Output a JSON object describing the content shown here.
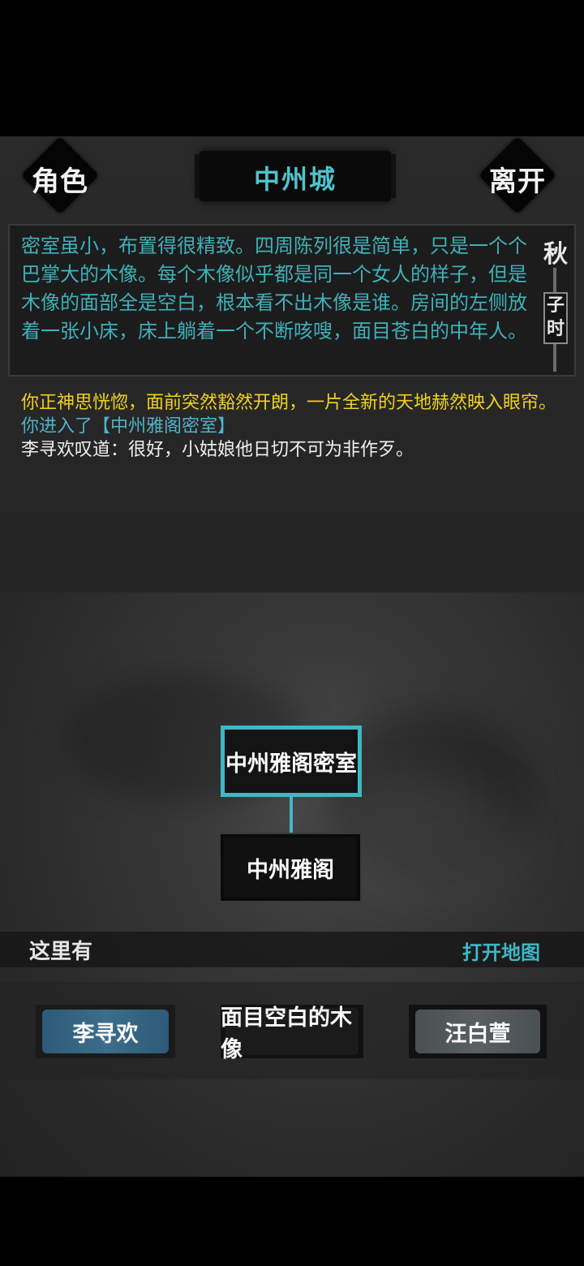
{
  "header": {
    "left_button": "角色",
    "city": "中州城",
    "right_button": "离开"
  },
  "description": "密室虽小，布置得很精致。四周陈列很是简单，只是一个个巴掌大的木像。每个木像似乎都是同一个女人的样子，但是木像的面部全是空白，根本看不出木像是谁。房间的左侧放着一张小床，床上躺着一个不断咳嗖，面目苍白的中年人。",
  "season": {
    "season": "秋",
    "hour_1": "子",
    "hour_2": "时"
  },
  "log": {
    "line1": "你正神思恍惚，面前突然豁然开朗，一片全新的天地赫然映入眼帘。",
    "line2": "你进入了【中州雅阁密室】",
    "line3": "李寻欢叹道：很好，小姑娘他日切不可为非作歹。"
  },
  "map": {
    "current_room": "中州雅阁密室",
    "adjacent_room": "中州雅阁"
  },
  "here": {
    "label": "这里有",
    "open_map": "打开地图"
  },
  "npcs": {
    "npc1": "李寻欢",
    "npc2": "面目空白的木像",
    "npc3": "汪白萱"
  },
  "colors": {
    "teal": "#3fb7c4",
    "yellow": "#f0d21e",
    "background": "#252525"
  }
}
